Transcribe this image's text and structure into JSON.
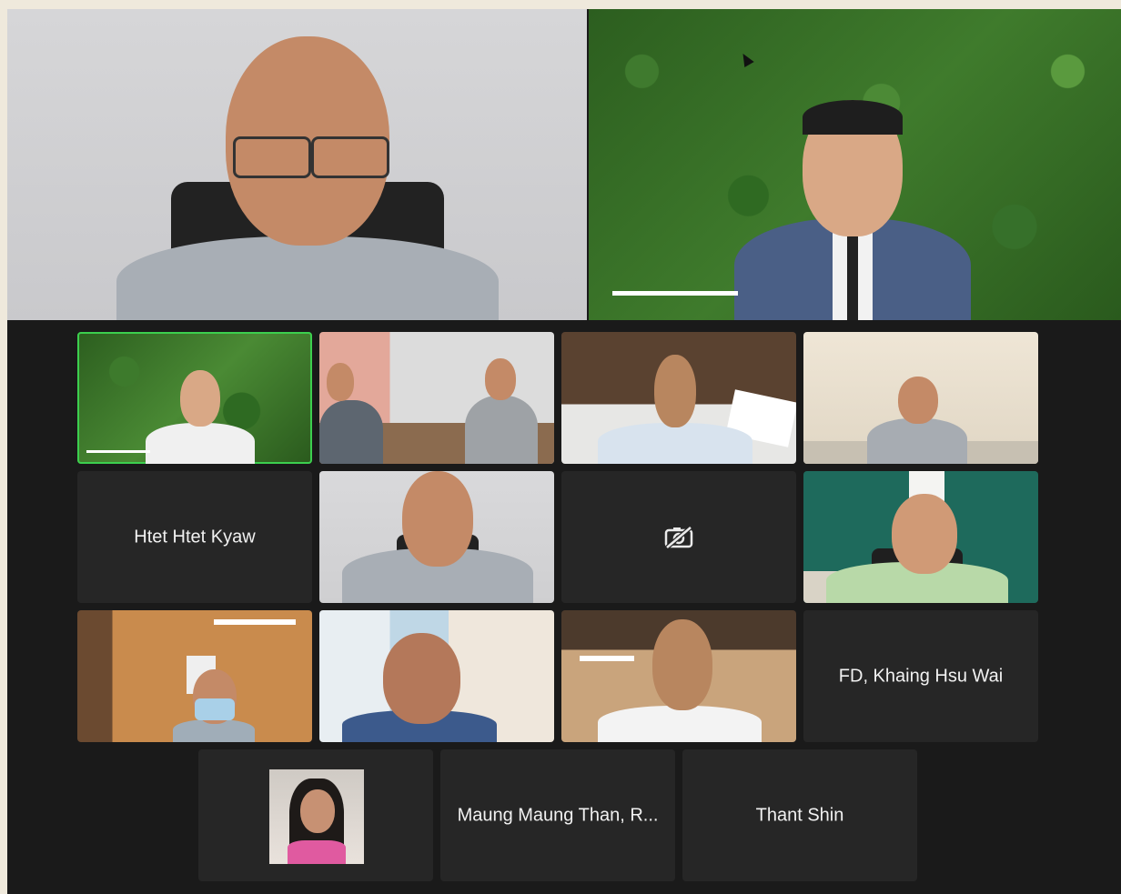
{
  "meeting": {
    "participants": [
      {
        "id": "p1",
        "name": "Htet Htet Kyaw",
        "video": false
      },
      {
        "id": "p2",
        "name": "",
        "video": false,
        "camera_off": true
      },
      {
        "id": "p3",
        "name": "FD, Khaing Hsu Wai",
        "video": false
      },
      {
        "id": "p4",
        "name": "Maung Maung Than, R...",
        "video": false
      },
      {
        "id": "p5",
        "name": "Thant Shin",
        "video": false
      }
    ]
  },
  "icons": {
    "camera_off": "video-camera-off-icon",
    "cursor": "mouse-pointer-icon"
  },
  "colors": {
    "active_speaker_border": "#3ccf4e",
    "tile_bg": "#262626",
    "window_bg": "#1a1a1a"
  }
}
